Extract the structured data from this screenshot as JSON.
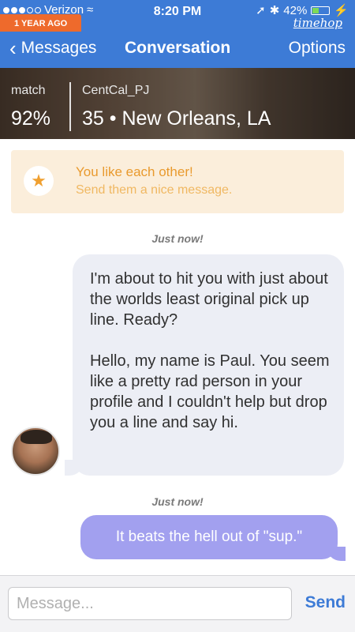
{
  "status_bar": {
    "carrier": "Verizon",
    "time": "8:20 PM",
    "battery": "42%",
    "battery_level": 0.42
  },
  "timehop": {
    "badge": "1 YEAR AGO",
    "logo": "timehop"
  },
  "navbar": {
    "back_label": "Messages",
    "title": "Conversation",
    "options_label": "Options"
  },
  "profile": {
    "match_label": "match",
    "match_percent": "92%",
    "username": "CentCal_PJ",
    "age_location": "35 • New Orleans, LA"
  },
  "banner": {
    "title": "You like each other!",
    "subtitle": "Send them a nice message."
  },
  "messages": [
    {
      "timestamp": "Just now!",
      "direction": "incoming",
      "paragraphs": [
        "I'm about to hit you with just about the worlds least original pick up line. Ready?",
        "Hello, my name is Paul. You seem like a pretty rad person in your profile and I couldn't help but drop you a line and say hi."
      ]
    },
    {
      "timestamp": "Just now!",
      "direction": "outgoing",
      "paragraphs": [
        "It beats the hell out of \"sup.\""
      ]
    }
  ],
  "compose": {
    "placeholder": "Message...",
    "send_label": "Send"
  },
  "colors": {
    "nav_blue": "#3d7bd6",
    "timehop_orange": "#ee6a2c",
    "banner_bg": "#fbeedb",
    "banner_accent": "#e99a2e",
    "outgoing_bubble": "#a2a0ef",
    "incoming_bubble": "#eceef5"
  }
}
